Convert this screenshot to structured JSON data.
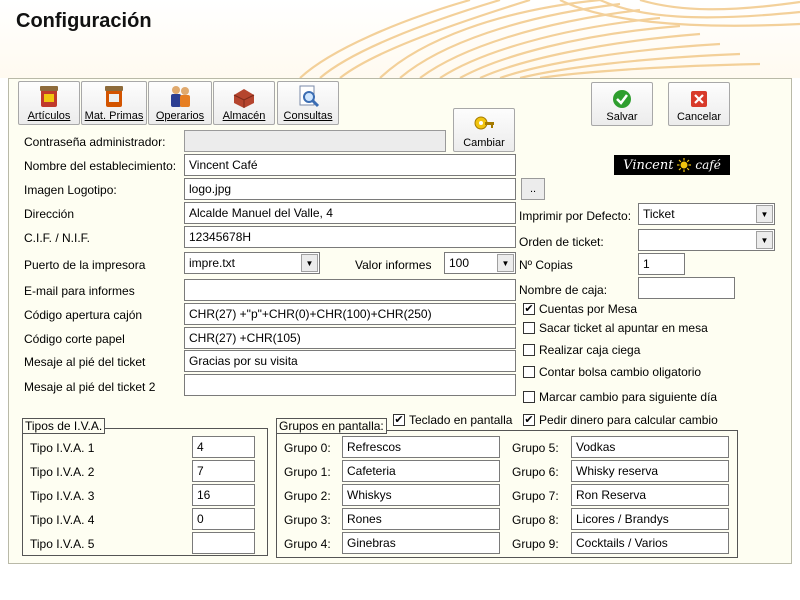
{
  "window": {
    "title": "Configuración"
  },
  "toolbar": {
    "articulos": "Artículos",
    "mat_primas": "Mat. Primas",
    "operarios": "Operarios",
    "almacen": "Almacén",
    "consultas": "Consultas",
    "salvar": "Salvar",
    "cancelar": "Cancelar",
    "cambiar": "Cambiar"
  },
  "form": {
    "admin_password": {
      "label": "Contraseña administrador:",
      "value": ""
    },
    "nombre": {
      "label": "Nombre del establecimiento:",
      "value": "Vincent Café"
    },
    "logo": {
      "label": "Imagen Logotipo:",
      "value": "logo.jpg",
      "browse": ".."
    },
    "direccion": {
      "label": "Dirección",
      "value": "Alcalde Manuel del Valle, 4"
    },
    "cif": {
      "label": "C.I.F. / N.I.F.",
      "value": "12345678H"
    },
    "puerto": {
      "label": "Puerto de la impresora",
      "value": "impre.txt"
    },
    "valor_informes": {
      "label": "Valor informes",
      "value": "100"
    },
    "email": {
      "label": "E-mail para informes",
      "value": ""
    },
    "cod_cajon": {
      "label": "Código apertura cajón",
      "value": "CHR(27) +\"p\"+CHR(0)+CHR(100)+CHR(250)"
    },
    "cod_corte": {
      "label": "Código corte papel",
      "value": "CHR(27) +CHR(105)"
    },
    "msg_pie": {
      "label": "Mesaje al pié del ticket",
      "value": "Gracias por su visita"
    },
    "msg_pie2": {
      "label": "Mesaje al pié del ticket 2",
      "value": ""
    }
  },
  "logo_image": {
    "text_left": "Vincent",
    "text_right": "café"
  },
  "right": {
    "imprimir": {
      "label": "Imprimir por Defecto:",
      "value": "Ticket"
    },
    "orden": {
      "label": "Orden de ticket:",
      "value": ""
    },
    "copias": {
      "label": "Nº Copias",
      "value": "1"
    },
    "nombre_caja": {
      "label": "Nombre de caja:",
      "value": ""
    },
    "checks": [
      {
        "label": "Cuentas por Mesa",
        "checked": true
      },
      {
        "label": "Sacar ticket al apuntar en mesa",
        "checked": false
      },
      {
        "label": "Realizar caja ciega",
        "checked": false
      },
      {
        "label": "Contar bolsa cambio oligatorio",
        "checked": false
      },
      {
        "label": "Marcar cambio para siguiente día",
        "checked": false
      },
      {
        "label": "Pedir dinero para calcular cambio",
        "checked": true
      }
    ],
    "check_mark": "✔"
  },
  "iva": {
    "title": "Tipos de I.V.A.",
    "items": [
      {
        "label": "Tipo I.V.A. 1",
        "value": "4"
      },
      {
        "label": "Tipo I.V.A. 2",
        "value": "7"
      },
      {
        "label": "Tipo I.V.A. 3",
        "value": "16"
      },
      {
        "label": "Tipo I.V.A. 4",
        "value": "0"
      },
      {
        "label": "Tipo I.V.A. 5",
        "value": ""
      }
    ]
  },
  "grupos": {
    "title": "Grupos en pantalla:",
    "teclado": {
      "label": "Teclado en pantalla",
      "checked": true
    },
    "items": [
      {
        "label": "Grupo 0:",
        "value": "Refrescos"
      },
      {
        "label": "Grupo 1:",
        "value": "Cafeteria"
      },
      {
        "label": "Grupo 2:",
        "value": "Whiskys"
      },
      {
        "label": "Grupo 3:",
        "value": "Rones"
      },
      {
        "label": "Grupo 4:",
        "value": "Ginebras"
      },
      {
        "label": "Grupo 5:",
        "value": "Vodkas"
      },
      {
        "label": "Grupo 6:",
        "value": "Whisky reserva"
      },
      {
        "label": "Grupo 7:",
        "value": "Ron Reserva"
      },
      {
        "label": "Grupo 8:",
        "value": "Licores / Brandys"
      },
      {
        "label": "Grupo 9:",
        "value": "Cocktails / Varios"
      }
    ]
  },
  "colors": {
    "panel": "#fefef2",
    "swirl": "#f2c98a",
    "salvar_green": "#2e9e2e",
    "cancel_red": "#d83a2a"
  }
}
